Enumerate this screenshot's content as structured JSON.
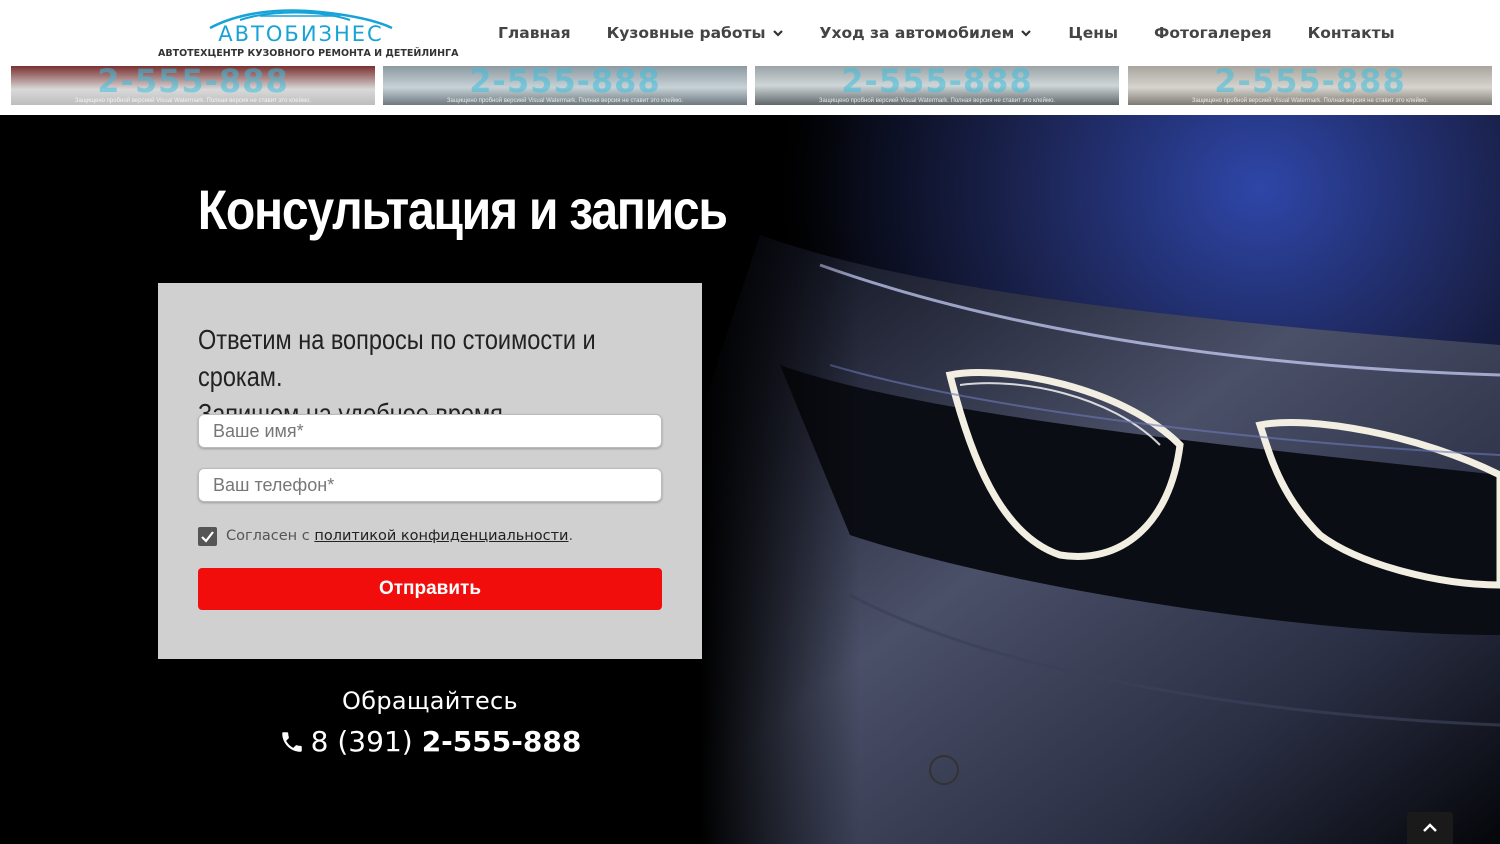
{
  "header": {
    "logo_word": "АВТОБИЗНЕС",
    "logo_tagline": "АВТОТЕХЦЕНТР КУЗОВНОГО РЕМОНТА И ДЕТЕЙЛИНГА",
    "nav": [
      {
        "label": "Главная",
        "has_dropdown": false
      },
      {
        "label": "Кузовные работы",
        "has_dropdown": true
      },
      {
        "label": "Уход за автомобилем",
        "has_dropdown": true
      },
      {
        "label": "Цены",
        "has_dropdown": false
      },
      {
        "label": "Фотогалерея",
        "has_dropdown": false
      },
      {
        "label": "Контакты",
        "has_dropdown": false
      }
    ]
  },
  "gallery": {
    "watermark": "2-555-888",
    "watermark_note": "Защищено пробной версией Visual Watermark. Полная версия не ставит это клеймо."
  },
  "consult": {
    "title": "Консультация и запись",
    "lead_line1": "Ответим на вопросы по стоимости и срокам.",
    "lead_line2": "Запишем на удобное время.",
    "name_placeholder": "Ваше имя*",
    "phone_placeholder": "Ваш телефон*",
    "consent_prefix": "Согласен с ",
    "consent_link": "политикой конфиденциальности",
    "consent_suffix": ".",
    "consent_checked": true,
    "submit_label": "Отправить"
  },
  "contact": {
    "heading": "Обращайтесь",
    "phone_prefix": "8 (391)",
    "phone_number": "2-555-888"
  },
  "colors": {
    "accent_red": "#f20d0d",
    "logo_blue": "#17a3d6",
    "form_bg": "#d0d0d0"
  },
  "icons": {
    "nav_dropdown": "chevron-down-icon",
    "phone": "phone-icon",
    "scroll_top": "chevron-up-icon",
    "consent": "checkmark-icon"
  }
}
